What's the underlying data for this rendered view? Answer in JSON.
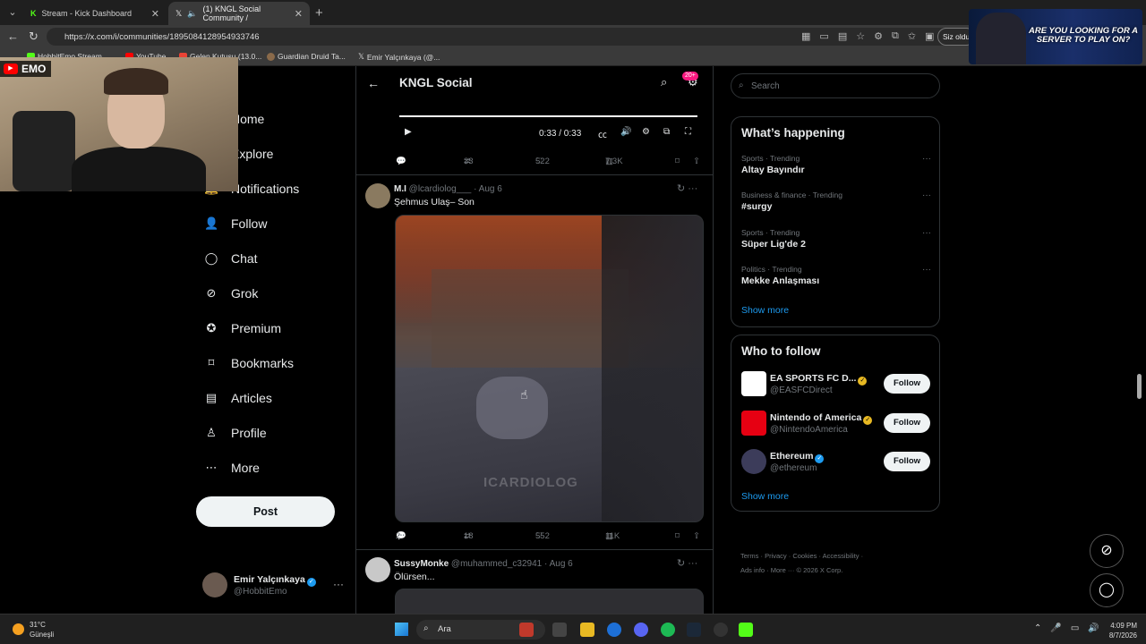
{
  "browser": {
    "tabs": [
      {
        "title": "Stream - Kick Dashboard",
        "active": false
      },
      {
        "title": "(1) KNGL Social Community /",
        "active": true
      }
    ],
    "url": "https://x.com/i/communities/1895084128954933746",
    "profile_btn": "Siz oldu",
    "bookmarks": [
      "HobbitEmo Stream",
      "YouTube",
      "Gelen Kutusu (13.0...",
      "Guardian Druid Ta...",
      "Emir Yalçınkaya (@..."
    ]
  },
  "webcam": {
    "channel_label": "EMO"
  },
  "ad": {
    "text": "ARE YOU LOOKING FOR A SERVER TO PLAY ON?"
  },
  "nav": {
    "items": [
      "Home",
      "Explore",
      "Notifications",
      "Follow",
      "Chat",
      "Grok",
      "Premium",
      "Bookmarks",
      "Articles",
      "Profile",
      "More"
    ],
    "post_label": "Post",
    "account": {
      "name": "Emir Yalçınkaya",
      "handle": "@HobbitEmo"
    }
  },
  "header": {
    "title": "KNGL Social",
    "badge": "20+"
  },
  "video": {
    "time": "0:33 / 0:33"
  },
  "tweets": [
    {
      "replies": "",
      "reposts": "33",
      "likes": "522",
      "views": "7.3K"
    },
    {
      "name": "M.I",
      "handle": "@lcardiolog___",
      "date": "· Aug 6",
      "text": "Şehmus Ulaş– Son",
      "watermark": "ICARDIOLOG",
      "replies": "2",
      "reposts": "18",
      "likes": "552",
      "views": "11K"
    },
    {
      "name": "SussyMonke",
      "handle": "@muhammed_c32941",
      "date": "· Aug 6",
      "text": "Ölürsen..."
    }
  ],
  "sidebar": {
    "search_placeholder": "Search",
    "happening_title": "What’s happening",
    "trends": [
      {
        "category": "Sports · Trending",
        "name": "Altay Bayındır"
      },
      {
        "category": "Business & finance · Trending",
        "name": "#surgy"
      },
      {
        "category": "Sports · Trending",
        "name": "Süper Lig'de 2"
      },
      {
        "category": "Politics · Trending",
        "name": "Mekke Anlaşması"
      }
    ],
    "show_more": "Show more",
    "who_title": "Who to follow",
    "who": [
      {
        "name": "EA SPORTS FC D...",
        "handle": "@EASFCDirect",
        "button": "Follow",
        "color": "#ffffff"
      },
      {
        "name": "Nintendo of America",
        "handle": "@NintendoAmerica",
        "button": "Follow",
        "color": "#e60012"
      },
      {
        "name": "Ethereum",
        "handle": "@ethereum",
        "button": "Follow",
        "color": "#3c3c5a"
      }
    ],
    "footer_line1": "Terms · Privacy · Cookies · Accessibility ·",
    "footer_line2": "Ads info · More ··· © 2026 X Corp."
  },
  "taskbar": {
    "temp": "31°C",
    "weather": "Güneşli",
    "search": "Ara",
    "time": "4:09 PM",
    "date": "8/7/2026"
  }
}
